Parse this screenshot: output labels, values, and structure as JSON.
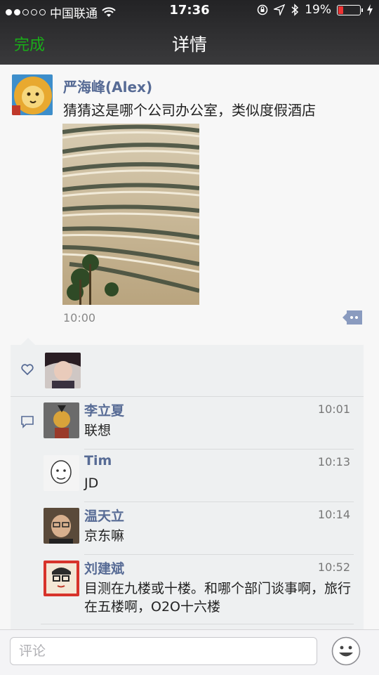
{
  "status_bar": {
    "carrier": "中国联通",
    "time": "17:36",
    "battery": "19%",
    "battery_level": 0.19
  },
  "nav": {
    "done_label": "完成",
    "title": "详情"
  },
  "post": {
    "author": "严海峰(Alex)",
    "text": "猜猜这是哪个公司办公室，类似度假酒店",
    "time": "10:00"
  },
  "comments": [
    {
      "name": "李立夏",
      "time": "10:01",
      "text": "联想"
    },
    {
      "name": "Tim",
      "time": "10:13",
      "text": "JD"
    },
    {
      "name": "温天立",
      "time": "10:14",
      "text": "京东嘛"
    },
    {
      "name": "刘建斌",
      "time": "10:52",
      "text": "目测在九楼或十楼。和哪个部门谈事啊，旅行在五楼啊，O2O十六楼"
    }
  ],
  "input": {
    "placeholder": "评论"
  },
  "colors": {
    "accent_green": "#1aad19",
    "name_blue": "#576b95",
    "battery_red": "#e33333"
  },
  "icons": [
    "wifi-icon",
    "lock-rotation-icon",
    "location-icon",
    "bluetooth-icon",
    "battery-icon",
    "charging-icon",
    "comment-action-icon",
    "like-heart-icon",
    "comment-bubble-icon",
    "emoji-icon"
  ]
}
